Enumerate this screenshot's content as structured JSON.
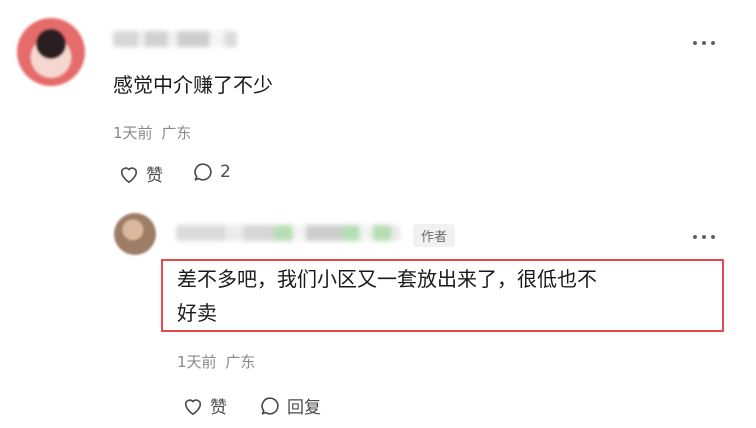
{
  "comment": {
    "text": "感觉中介赚了不少",
    "time": "1天前",
    "location": "广东",
    "like_label": "赞",
    "reply_count": "2"
  },
  "reply": {
    "author_badge": "作者",
    "text_line1": "差不多吧，我们小区又一套放出来了，很低也不",
    "text_line2": "好卖",
    "time": "1天前",
    "location": "广东",
    "like_label": "赞",
    "reply_label": "回复"
  },
  "colors": {
    "highlight_border": "#e24a4f",
    "text_primary": "#1a1a1a",
    "text_meta": "#8a8a8a"
  },
  "icons": [
    "heart-icon",
    "comment-bubble-icon",
    "more-dots-icon"
  ]
}
